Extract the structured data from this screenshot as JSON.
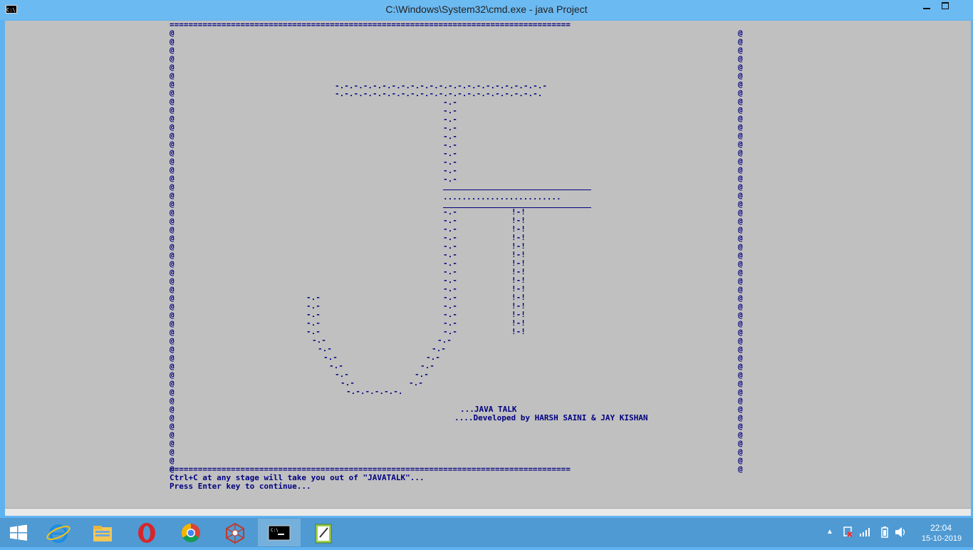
{
  "window": {
    "title": "C:\\Windows\\System32\\cmd.exe - java  Project",
    "icon_text": "C:\\."
  },
  "console": {
    "border_top": "=====================================================================================",
    "border_bottom": "=====================================================================================",
    "border_char": "@",
    "logo": {
      "top_bar_1": "-.-.-.-.-.-.-.-.-.-.-.-.-.-.-.-.-.-.-.-.-.-.-",
      "top_bar_2": "-.-.-.-.-.-.-.-.-.-.-.-.-.-.-.-.-.-.-.-.-.-.",
      "j_stem_segment": "-.-",
      "t_crossbar": ".........................",
      "t_stem_segment": "!-!",
      "j_hook_lines": [
        "-.-",
        "-.-",
        "-.-",
        "-.-",
        "-.-",
        " -.-",
        "  -.-",
        "   -.-",
        "    -.-",
        "     -.-",
        "      -.-",
        "       -.-.-.-.-.-."
      ],
      "j_hook_right_lines": [
        "-.-",
        "-.-",
        "-.-",
        "-.-",
        "-.-",
        "-.-"
      ]
    },
    "title_line": "...JAVA TALK",
    "credit_line": "....Developed by HARSH SAINI & JAY KISHAN",
    "hint_line": "Ctrl+C at any stage will take you out of \"JAVATALK\"...",
    "prompt_line": "Press Enter key to continue..."
  },
  "taskbar": {
    "items": [
      {
        "name": "internet-explorer",
        "active": false
      },
      {
        "name": "file-explorer",
        "active": false
      },
      {
        "name": "opera",
        "active": false
      },
      {
        "name": "chrome",
        "active": false
      },
      {
        "name": "network-app",
        "active": false
      },
      {
        "name": "command-prompt",
        "active": true
      },
      {
        "name": "text-editor",
        "active": false
      }
    ],
    "clock_time": "22:04",
    "clock_date": "15-10-2019"
  },
  "colors": {
    "console_bg": "#c0c0c0",
    "console_text": "#000080",
    "titlebar": "#6cbaf2",
    "taskbar": "#4f9ad3"
  }
}
